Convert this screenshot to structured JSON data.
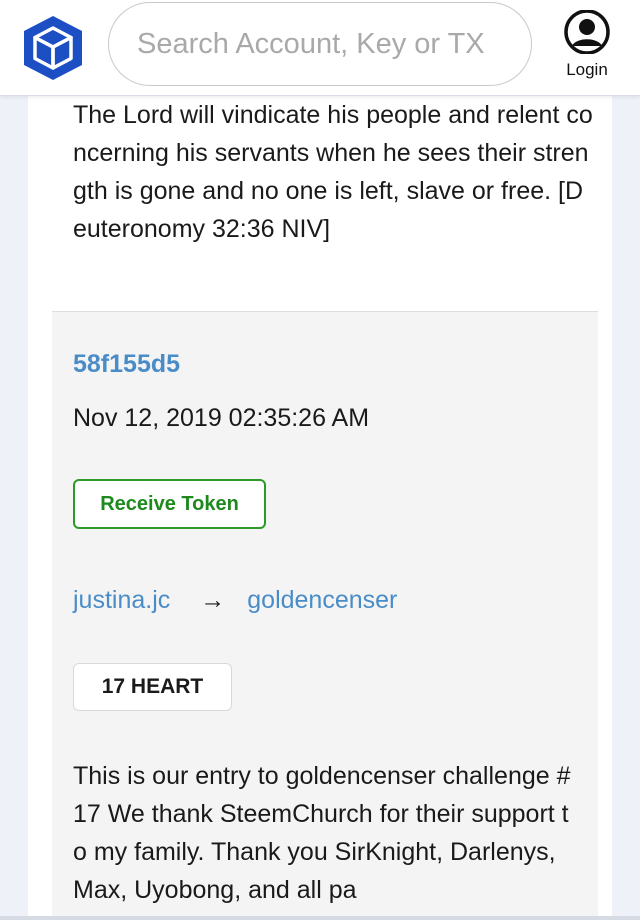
{
  "header": {
    "search_placeholder": "Search Account, Key or TX",
    "login_label": "Login"
  },
  "colors": {
    "brand_blue": "#1c4fc4",
    "link_blue": "#4a8cc7",
    "success_green": "#1e8a1e"
  },
  "icons": {
    "logo": "cube-logo-icon",
    "login": "user-account-icon"
  },
  "previous_memo": "The Lord will vindicate his people and relent concerning his servants when he sees their strength is gone and no one is left, slave or free. [Deuteronomy 32:36 NIV]",
  "transaction": {
    "hash": "58f155d5",
    "timestamp": "Nov 12, 2019 02:35:26 AM",
    "operation": "Receive Token",
    "from": "justina.jc",
    "arrow": "→",
    "to": "goldencenser",
    "amount": "17 HEART",
    "memo": "This is our entry to goldencenser challenge #17 We thank SteemChurch for their support to my family. Thank you SirKnight, Darlenys, Max, Uyobong, and all pa"
  }
}
